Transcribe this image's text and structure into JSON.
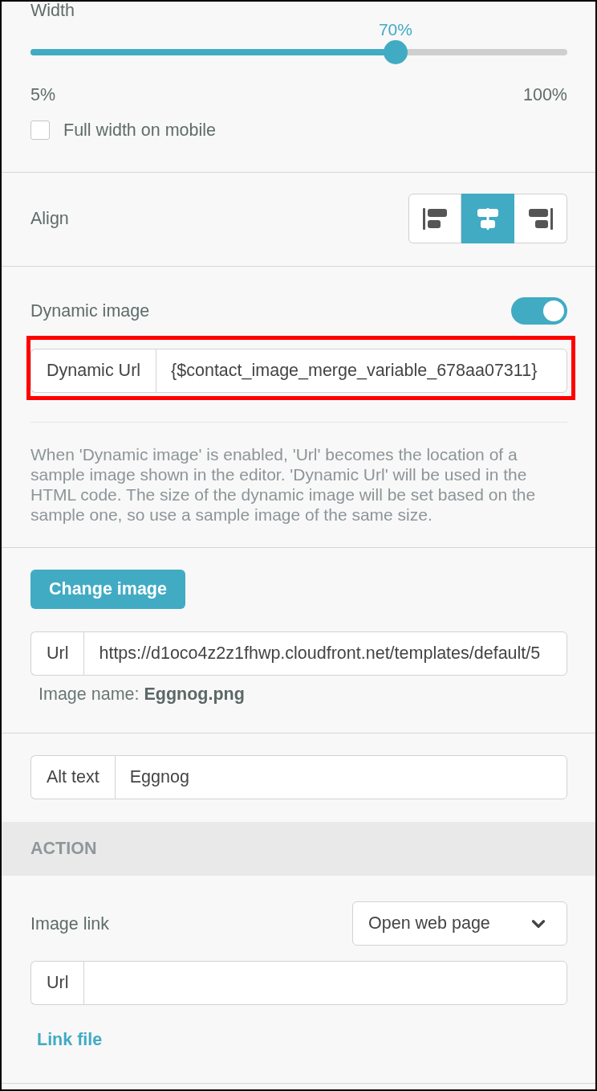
{
  "width": {
    "label": "Width",
    "value_label": "70%",
    "level": 0.68,
    "min_label": "5%",
    "max_label": "100%"
  },
  "full_width_on_mobile": {
    "label": "Full width on mobile",
    "checked": false
  },
  "align": {
    "label": "Align",
    "options": [
      {
        "kind": "left",
        "selected": false
      },
      {
        "kind": "center",
        "selected": true
      },
      {
        "kind": "right",
        "selected": false
      }
    ]
  },
  "dynamic_image": {
    "label": "Dynamic image",
    "on": true,
    "field": {
      "addon": "Dynamic Url",
      "value": "{$contact_image_merge_variable_678aa07311}",
      "highlighted": true
    },
    "help": "When 'Dynamic image' is enabled, 'Url' becomes the location of a sample image shown in the editor. 'Dynamic Url' will be used in the HTML code. The size of the dynamic image will be set based on the sample one, so use a sample image of the same size."
  },
  "image": {
    "button": "Change image",
    "url": {
      "addon": "Url",
      "value": "https://d1oco4z2z1fhwp.cloudfront.net/templates/default/5"
    },
    "image_name": "Image name: **Eggnog.png**"
  },
  "alt_text": {
    "addon": "Alt text",
    "value": "Eggnog"
  },
  "action": {
    "title": "ACTION",
    "image_link": {
      "label": "Image link",
      "select": "Open web page"
    },
    "url": {
      "addon": "Url"
    },
    "link_file": "Link file"
  }
}
